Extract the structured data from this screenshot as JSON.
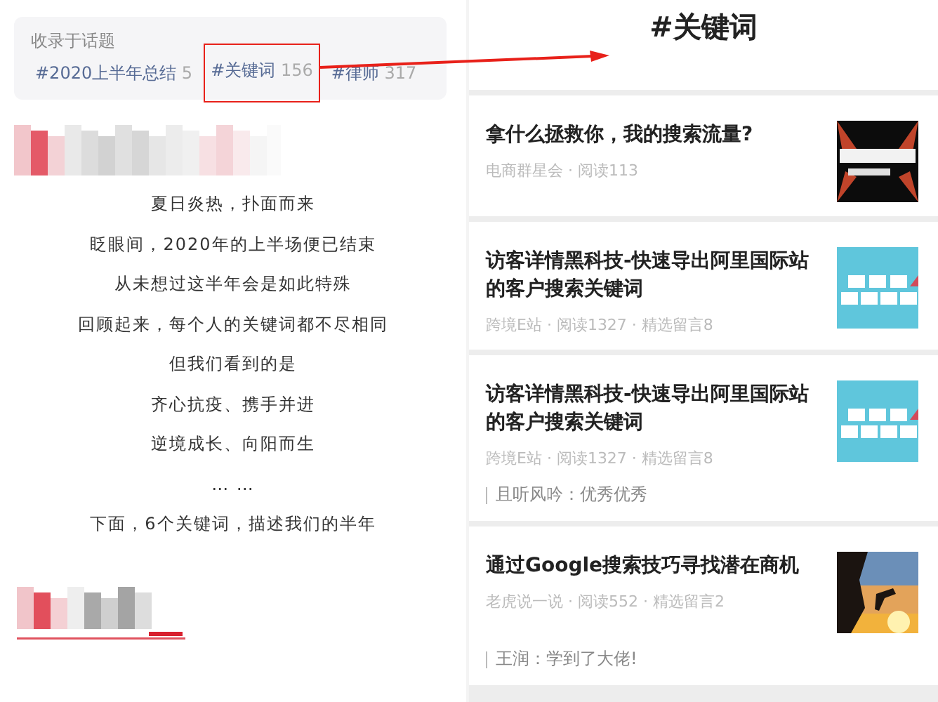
{
  "topic_card": {
    "heading": "收录于话题",
    "tags": [
      {
        "name": "#2020上半年总结",
        "count": "5",
        "highlighted": false
      },
      {
        "name": "#关键词",
        "count": "156",
        "highlighted": true
      },
      {
        "name": "#律师",
        "count": "317",
        "highlighted": false
      }
    ]
  },
  "article_lines": [
    "夏日炎热，扑面而来",
    "眨眼间，2020年的上半场便已结束",
    "从未想过这半年会是如此特殊",
    "回顾起来，每个人的关键词都不尽相同",
    "但我们看到的是",
    "齐心抗疫、携手并进",
    "逆境成长、向阳而生",
    "… …",
    "下面，6个关键词，描述我们的半年"
  ],
  "topic_page": {
    "title": "#关键词",
    "articles": [
      {
        "title": "拿什么拯救你，我的搜索流量?",
        "meta": "电商群星会 · 阅读113"
      },
      {
        "title": "访客详情黑科技-快速导出阿里国际站的客户搜索关键词",
        "meta": "跨境E站 · 阅读1327 · 精选留言8"
      },
      {
        "title": "访客详情黑科技-快速导出阿里国际站的客户搜索关键词",
        "meta": "跨境E站 · 阅读1327 · 精选留言8",
        "comment": "且听风吟：优秀优秀"
      },
      {
        "title": "通过Google搜索技巧寻找潜在商机",
        "meta": "老虎说一说 · 阅读552 · 精选留言2",
        "comment": "王润：学到了大佬!"
      }
    ]
  }
}
